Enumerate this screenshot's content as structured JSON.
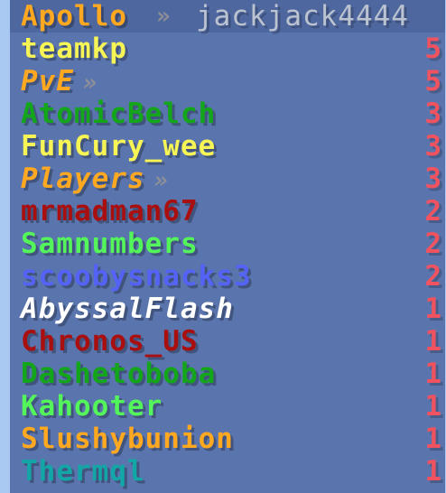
{
  "header": {
    "server": "Apollo",
    "chevron": "»",
    "username": "jackjack4444"
  },
  "colors": {
    "background": "#a9c9f2",
    "panel": "#5a75ad",
    "header_row": "#4f679f",
    "score": "#f0535f",
    "chevron": "#8d8f96"
  },
  "rows": [
    {
      "name": "teamkp",
      "score": "5",
      "color": "#f7f455",
      "italic": false,
      "chevron": ""
    },
    {
      "name": "PvE",
      "score": "5",
      "color": "#ffa820",
      "italic": true,
      "chevron": "»"
    },
    {
      "name": "AtomicBelch",
      "score": "3",
      "color": "#13a61a",
      "italic": false,
      "chevron": ""
    },
    {
      "name": "FunCury_wee",
      "score": "3",
      "color": "#f7f455",
      "italic": false,
      "chevron": ""
    },
    {
      "name": "Players",
      "score": "3",
      "color": "#ffa820",
      "italic": true,
      "chevron": "»"
    },
    {
      "name": "mrmadman67",
      "score": "2",
      "color": "#aa0f0f",
      "italic": false,
      "chevron": ""
    },
    {
      "name": "Samnumbers",
      "score": "2",
      "color": "#54f55a",
      "italic": false,
      "chevron": ""
    },
    {
      "name": "scoobysnacks3",
      "score": "2",
      "color": "#5462f5",
      "italic": false,
      "chevron": ""
    },
    {
      "name": "AbyssalFlash",
      "score": "1",
      "color": "#ffffff",
      "italic": true,
      "chevron": ""
    },
    {
      "name": "Chronos_US",
      "score": "1",
      "color": "#aa0f0f",
      "italic": false,
      "chevron": ""
    },
    {
      "name": "Dashetoboba",
      "score": "1",
      "color": "#13a61a",
      "italic": false,
      "chevron": ""
    },
    {
      "name": "Kahooter",
      "score": "1",
      "color": "#54f55a",
      "italic": false,
      "chevron": ""
    },
    {
      "name": "Slushybunion",
      "score": "1",
      "color": "#ffa820",
      "italic": false,
      "chevron": ""
    },
    {
      "name": "Thermql",
      "score": "1",
      "color": "#12a6a6",
      "italic": false,
      "chevron": ""
    }
  ]
}
